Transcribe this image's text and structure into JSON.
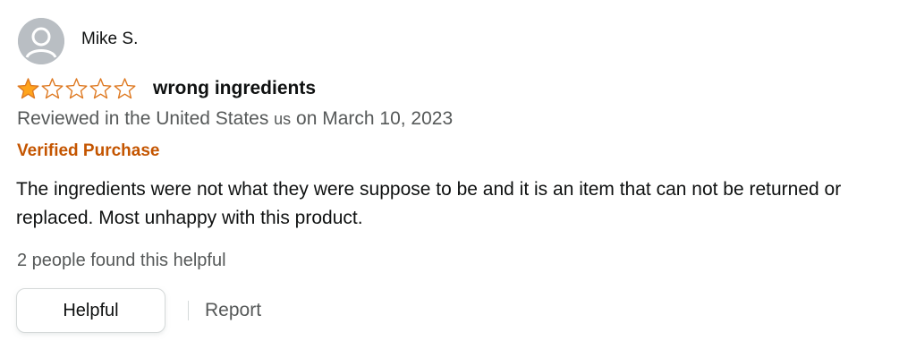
{
  "review": {
    "reviewer_name": "Mike S.",
    "rating": 1,
    "rating_max": 5,
    "title": "wrong ingredients",
    "date_prefix": "Reviewed in the United States ",
    "country_code": "us",
    "date_suffix": " on March 10, 2023",
    "verified_label": "Verified Purchase",
    "body": "The ingredients were not what they were suppose to be and it is an item that can not be returned or replaced. Most unhappy with this product.",
    "helpful_count_text": "2 people found this helpful",
    "helpful_button_label": "Helpful",
    "report_label": "Report"
  },
  "icons": {
    "avatar": "default-user-avatar-icon",
    "star_filled": "star-filled-icon",
    "star_empty": "star-empty-icon"
  },
  "colors": {
    "star": "#ffa41c",
    "star_outline": "#de7921",
    "verified": "#c45500",
    "secondary_text": "#565959",
    "avatar_bg": "#b9bec3"
  }
}
